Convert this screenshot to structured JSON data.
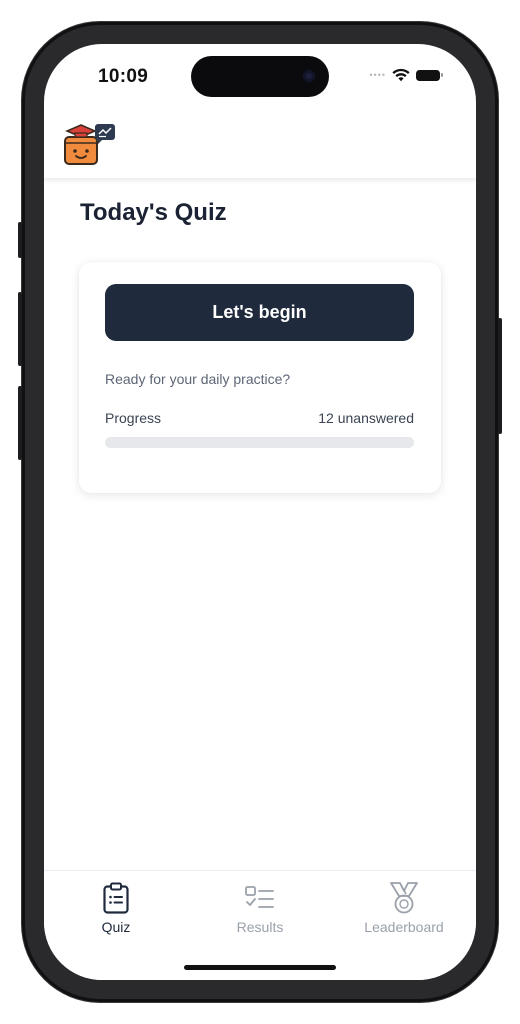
{
  "status_bar": {
    "time": "10:09"
  },
  "header": {
    "logo_icon": "graduation-box-mascot-icon"
  },
  "page": {
    "title": "Today's Quiz"
  },
  "quiz_card": {
    "begin_label": "Let's begin",
    "subtitle": "Ready for your daily practice?",
    "progress_label": "Progress",
    "progress_status": "12 unanswered",
    "progress_fraction": 0
  },
  "tabs": [
    {
      "label": "Quiz",
      "icon": "clipboard-list-icon",
      "active": true
    },
    {
      "label": "Results",
      "icon": "checklist-icon",
      "active": false
    },
    {
      "label": "Leaderboard",
      "icon": "medal-icon",
      "active": false
    }
  ],
  "colors": {
    "primary": "#1f2a3d",
    "title": "#1a2233",
    "inactive_tab": "#9aa1aa",
    "track": "#e6e8eb",
    "logo_orange": "#f08a3c"
  }
}
